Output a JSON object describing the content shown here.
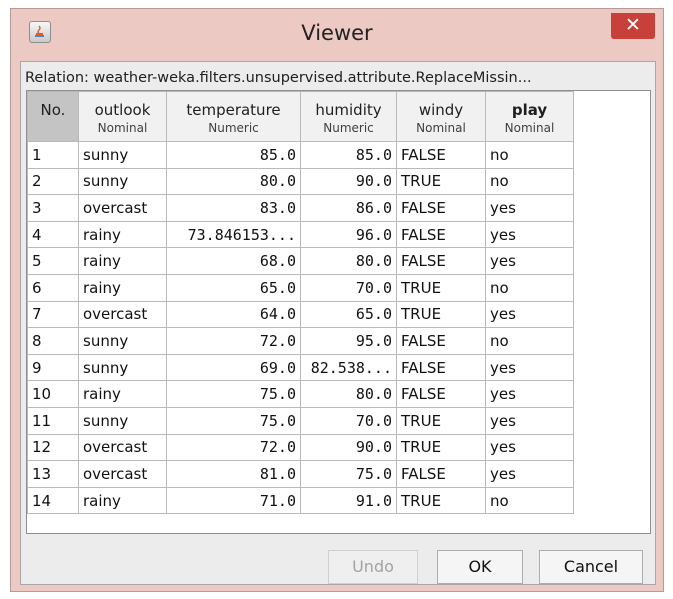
{
  "window": {
    "title": "Viewer",
    "close_label": "✕"
  },
  "relation": "Relation: weather-weka.filters.unsupervised.attribute.ReplaceMissin...",
  "columns": [
    {
      "name": "No.",
      "type": ""
    },
    {
      "name": "outlook",
      "type": "Nominal"
    },
    {
      "name": "temperature",
      "type": "Numeric"
    },
    {
      "name": "humidity",
      "type": "Numeric"
    },
    {
      "name": "windy",
      "type": "Nominal"
    },
    {
      "name": "play",
      "type": "Nominal"
    }
  ],
  "rows": [
    [
      "1",
      "sunny",
      "85.0",
      "85.0",
      "FALSE",
      "no"
    ],
    [
      "2",
      "sunny",
      "80.0",
      "90.0",
      "TRUE",
      "no"
    ],
    [
      "3",
      "overcast",
      "83.0",
      "86.0",
      "FALSE",
      "yes"
    ],
    [
      "4",
      "rainy",
      "73.846153...",
      "96.0",
      "FALSE",
      "yes"
    ],
    [
      "5",
      "rainy",
      "68.0",
      "80.0",
      "FALSE",
      "yes"
    ],
    [
      "6",
      "rainy",
      "65.0",
      "70.0",
      "TRUE",
      "no"
    ],
    [
      "7",
      "overcast",
      "64.0",
      "65.0",
      "TRUE",
      "yes"
    ],
    [
      "8",
      "sunny",
      "72.0",
      "95.0",
      "FALSE",
      "no"
    ],
    [
      "9",
      "sunny",
      "69.0",
      "82.538...",
      "FALSE",
      "yes"
    ],
    [
      "10",
      "rainy",
      "75.0",
      "80.0",
      "FALSE",
      "yes"
    ],
    [
      "11",
      "sunny",
      "75.0",
      "70.0",
      "TRUE",
      "yes"
    ],
    [
      "12",
      "overcast",
      "72.0",
      "90.0",
      "TRUE",
      "yes"
    ],
    [
      "13",
      "overcast",
      "81.0",
      "75.0",
      "FALSE",
      "yes"
    ],
    [
      "14",
      "rainy",
      "71.0",
      "91.0",
      "TRUE",
      "no"
    ]
  ],
  "buttons": {
    "undo": "Undo",
    "ok": "OK",
    "cancel": "Cancel"
  },
  "colors": {
    "window_frame": "#edc9c4",
    "close_button": "#c7403a"
  }
}
